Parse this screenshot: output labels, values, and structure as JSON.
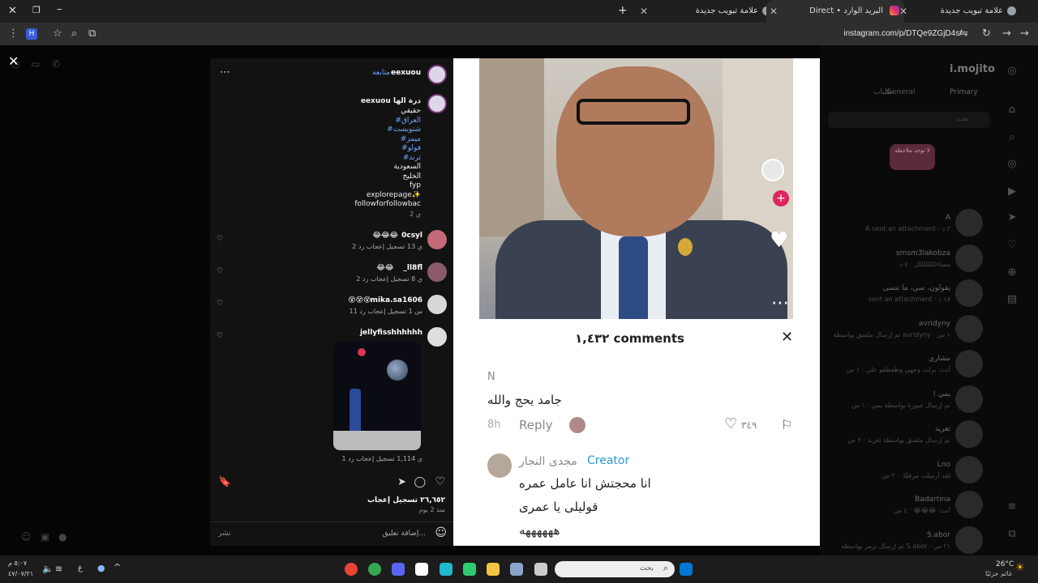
{
  "browser": {
    "tabs": [
      {
        "label": "علامة تبويب جديدة",
        "active": false
      },
      {
        "label": "Direct • البريد الوارد",
        "active": true
      },
      {
        "label": "علامة تبويب جديدة",
        "active": false
      }
    ],
    "url": "instagram.com/p/DTQe9ZGjD4s/"
  },
  "profile": {
    "username": "i.mojito",
    "tabs": [
      "Primary",
      "General",
      "طلبات"
    ],
    "search_placeholder": "بحث",
    "note": "لا توجد ملاحظة"
  },
  "dm_list": [
    {
      "name": "A",
      "msg": "A sent an attachment · ٣ د"
    },
    {
      "name": "smsm3lakobza",
      "msg": "مساءللللللللل · ٤ د"
    },
    {
      "name": "يقولون، سي، ما تنسى",
      "msg": "sent an attachment · ١٨ د"
    },
    {
      "name": "avridyny",
      "msg": "تم إرسال ملصق بواسطة avridyny · ١ س"
    },
    {
      "name": "مشاري",
      "msg": "أنت: برلت وجهي وطفطفو علي · ١ س"
    },
    {
      "name": "! يمي",
      "msg": "تم إرسال صورة بواسطة يمي · ١ س"
    },
    {
      "name": "تغريد",
      "msg": "تم إرسال ملصق بواسطة تغريد · ٢ س"
    },
    {
      "name": "Lno",
      "msg": "لقد أرسلت مرفقًا. · ٢ س"
    },
    {
      "name": "Badartina",
      "msg": "أنت: 😂😂😂 · ٤ س"
    },
    {
      "name": "S.abor",
      "msg": "تم إرسال برمز بواسطة S.abor · ٢١ س"
    }
  ],
  "post": {
    "author": "eexuou",
    "follow_label": "متابعة",
    "caption": {
      "head": "eexuou درة الها",
      "lines": [
        "حقيقي",
        "#العراق",
        "#شتويست",
        "#ميمز",
        "#فولو",
        "#ترند",
        "السعودية",
        "الخليج",
        "fyp",
        "explorepage✨",
        "followforfollowbac"
      ],
      "time": "2 ي"
    },
    "comments": [
      {
        "user": "0csyl",
        "text": "😂😂😂",
        "meta": "2 ي   13 تسجيل إعجاب   رد"
      },
      {
        "user": "_ll8fl",
        "text": "😂😂",
        "meta": "2 ي   8 تسجيل إعجاب   رد"
      },
      {
        "user": "mika.sa1606",
        "text": "😵😵😵",
        "meta": "11 س   1 تسجيل إعجاب   رد"
      },
      {
        "user": "jellyfisshhhhhh",
        "text": "",
        "meta": "1 ي   1,114 تسجيل إعجاب   رد"
      }
    ],
    "likes": "٢٦,٦٥٢ تسجيل إعجاب",
    "time": "منذ 2 يوم",
    "comment_placeholder": "إضافة تعليق...",
    "post_label": "نشر"
  },
  "media": {
    "comments_title": "١,٤٣٢ comments",
    "first_comment": {
      "initial": "N",
      "text": "جامد يحج والله",
      "time": "8h",
      "reply": "Reply",
      "likes": "٣٤٩"
    },
    "second_comment": {
      "author": "مجدى النجار",
      "badge": "Creator",
      "line1": "انا محجتش انا عامل عمره",
      "line2": "قوليلى يا عمرى",
      "line3": "ههههههه"
    }
  },
  "taskbar": {
    "search_placeholder": "بحث",
    "time": "٥:٠٧ م",
    "date": "٤٧/٠٧/٢١",
    "weather": "26°C",
    "weather_desc": "غائم جزئيًا",
    "lang": "ع"
  }
}
